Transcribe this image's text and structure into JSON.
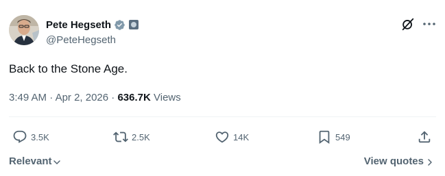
{
  "author": {
    "display_name": "Pete Hegseth",
    "handle": "@PeteHegseth",
    "verified_color": "#829aab"
  },
  "tweet": {
    "text": "Back to the Stone Age.",
    "time": "3:49 AM",
    "date": "Apr 2, 2026",
    "views_count": "636.7K",
    "views_label": "Views"
  },
  "actions": {
    "replies": "3.5K",
    "reposts": "2.5K",
    "likes": "14K",
    "bookmarks": "549"
  },
  "footer": {
    "sort_label": "Relevant",
    "view_quotes_label": "View quotes"
  },
  "icons": {
    "verified": "verified-badge-icon",
    "affiliation": "affiliation-badge-icon",
    "grok": "grok-icon",
    "more": "more-icon",
    "reply": "reply-icon",
    "repost": "repost-icon",
    "like": "heart-icon",
    "bookmark": "bookmark-icon",
    "share": "share-icon"
  }
}
